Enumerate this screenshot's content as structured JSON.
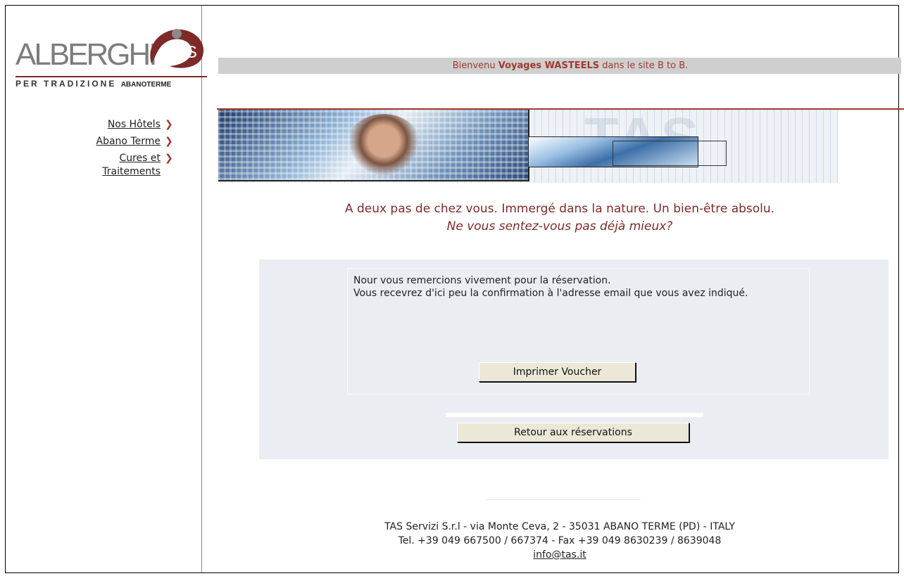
{
  "logo": {
    "wordmark": "ALBERGHI",
    "badge": "TAS",
    "tagline": "PER TRADIZIONE",
    "place": "ABANOTERME"
  },
  "nav": {
    "items": [
      {
        "label": "Nos Hôtels"
      },
      {
        "label": "Abano Terme"
      },
      {
        "label": "Cures et\nTraitements"
      }
    ]
  },
  "welcome": {
    "prefix": "Bienvenu",
    "agency": "Voyages WASTEELS",
    "suffix": "dans le site B to B."
  },
  "slogan": {
    "line1": "A deux pas de chez vous. Immergé dans la nature. Un bien-être absolu.",
    "line2": "Ne vous sentez-vous pas déjà mieux?"
  },
  "confirmation": {
    "message_line1": "Nour vous remercions vivement pour la réservation.",
    "message_line2": "Vous recevrez d'ici peu la confirmation à l'adresse email que vous avez indiqué.",
    "print_button": "Imprimer Voucher",
    "back_button": "Retour aux réservations"
  },
  "footer": {
    "address": "TAS Servizi S.r.l - via Monte Ceva, 2 - 35031 ABANO TERME (PD) - ITALY",
    "phones": "Tel. +39 049 667500 / 667374 - Fax +39 049 8630239 / 8639048",
    "email": "info@tas.it"
  },
  "colors": {
    "accent": "#a0392e",
    "welcome_bar": "#cfcfcf",
    "panel": "#eaedf2",
    "button": "#ece8d8"
  }
}
